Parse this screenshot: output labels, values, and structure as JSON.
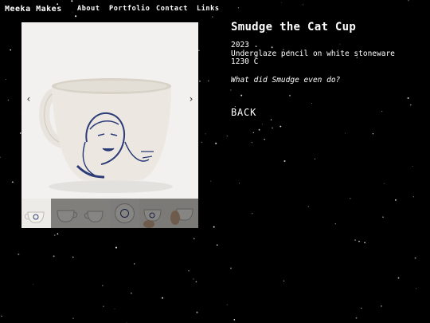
{
  "site": {
    "brand": "Meeka Makes"
  },
  "nav": {
    "about": "About",
    "portfolio": "Portfolio",
    "contact": "Contact",
    "links": "Links"
  },
  "gallery": {
    "prev_glyph": "‹",
    "next_glyph": "›",
    "selected_index": 0,
    "thumbnail_count": 6
  },
  "piece": {
    "title": "Smudge the Cat Cup",
    "year": "2023",
    "medium": "Underglaze pencil on white stoneware",
    "firing": "1230 C",
    "note": "What did Smudge even do?"
  },
  "actions": {
    "back_label": "BACK"
  }
}
